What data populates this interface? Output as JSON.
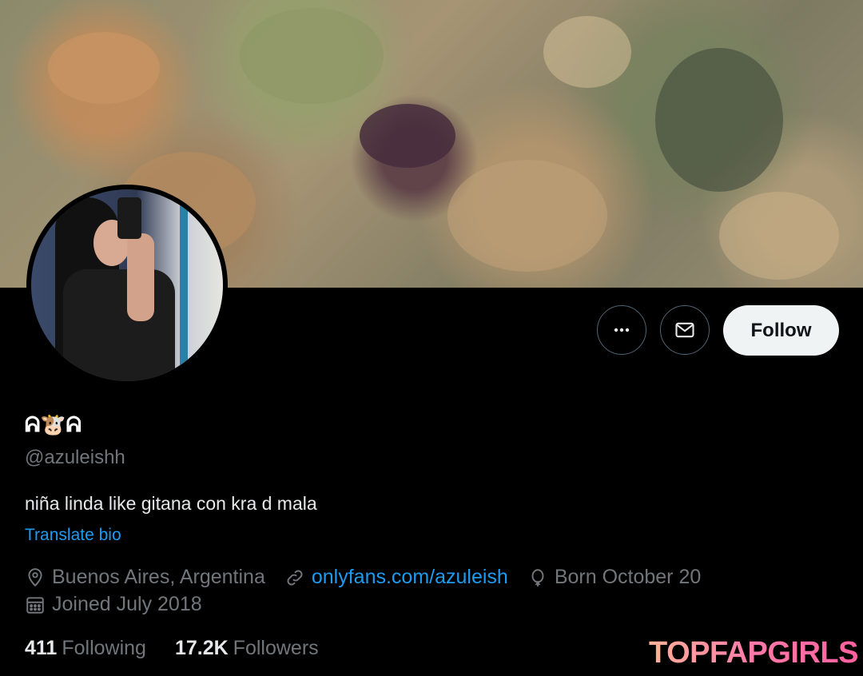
{
  "profile": {
    "display_name": "ᕱ🐮ᕱ",
    "handle": "@azuleishh",
    "bio": "niña linda like gitana con kra d mala",
    "translate_label": "Translate bio",
    "location": "Buenos Aires, Argentina",
    "website": "onlyfans.com/azuleish",
    "birthday": "Born October 20",
    "joined": "Joined July 2018"
  },
  "actions": {
    "more_icon": "more-icon",
    "message_icon": "envelope-icon",
    "follow_label": "Follow"
  },
  "stats": {
    "following_count": "411",
    "following_label": "Following",
    "followers_count": "17.2K",
    "followers_label": "Followers"
  },
  "icons": {
    "location": "location-pin-icon",
    "link": "link-icon",
    "birthday": "balloon-icon",
    "joined": "calendar-icon"
  },
  "watermark": "TOPFAPGIRLS",
  "colors": {
    "link": "#1d9bf0",
    "muted": "#71767b",
    "follow_bg": "#eff3f4"
  }
}
